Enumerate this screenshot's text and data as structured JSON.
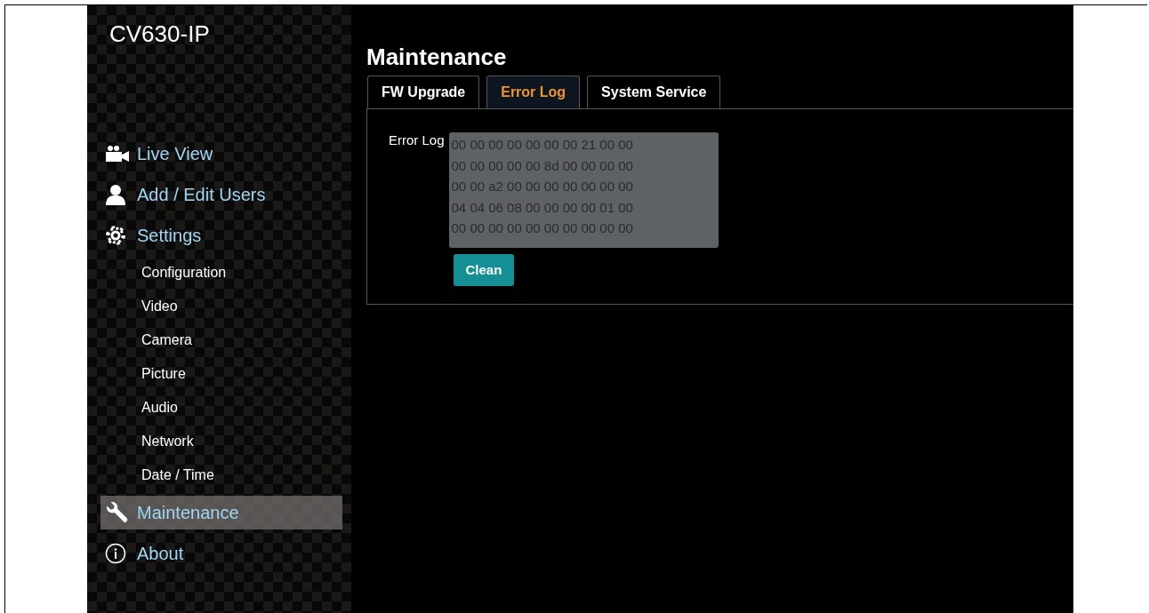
{
  "brand": "CV630-IP",
  "nav": [
    {
      "label": "Live View",
      "kind": "main",
      "selected": false
    },
    {
      "label": "Add / Edit Users",
      "kind": "main",
      "selected": false
    },
    {
      "label": "Settings",
      "kind": "main",
      "selected": false
    },
    {
      "label": "Configuration",
      "kind": "sub",
      "selected": false
    },
    {
      "label": "Video",
      "kind": "sub",
      "selected": false
    },
    {
      "label": "Camera",
      "kind": "sub",
      "selected": false
    },
    {
      "label": "Picture",
      "kind": "sub",
      "selected": false
    },
    {
      "label": "Audio",
      "kind": "sub",
      "selected": false
    },
    {
      "label": "Network",
      "kind": "sub",
      "selected": false
    },
    {
      "label": "Date / Time",
      "kind": "sub",
      "selected": false
    },
    {
      "label": "Maintenance",
      "kind": "main",
      "selected": true
    },
    {
      "label": "About",
      "kind": "main",
      "selected": false
    }
  ],
  "page_title": "Maintenance",
  "tabs": [
    {
      "label": "FW Upgrade",
      "selected": false
    },
    {
      "label": "Error Log",
      "selected": true
    },
    {
      "label": "System Service",
      "selected": false
    }
  ],
  "error_log": {
    "label": "Error Log",
    "lines": [
      "00 00 00 00 00 00 00 21 00 00",
      "00 00 00 00 00 8d 00 00 00 00",
      "00 00 a2 00 00 00 00 00 00 00",
      "04 04 06 08 00 00 00 00 01 00",
      "00 00 00 00 00 00 00 00 00 00"
    ],
    "button": "Clean"
  }
}
